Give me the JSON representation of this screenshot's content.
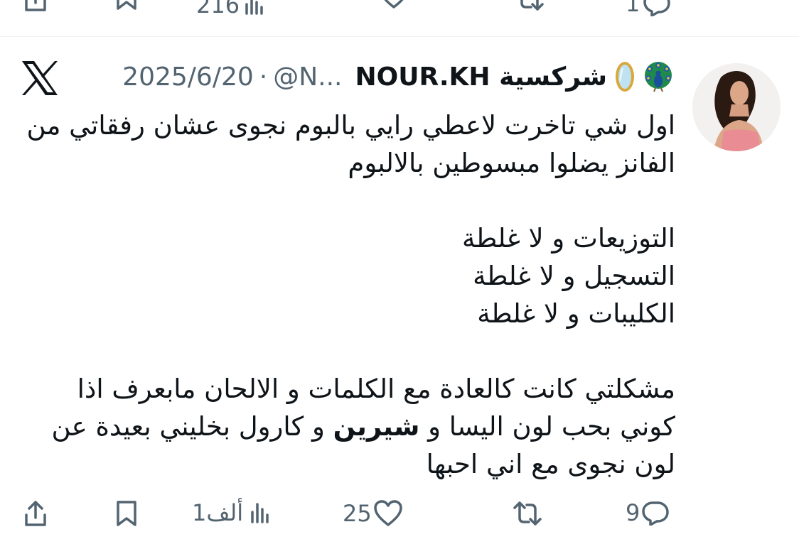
{
  "previous_tweet_actions": {
    "views": "216",
    "replies": "1"
  },
  "header": {
    "display_name": "NOUR.KH",
    "display_name_suffix": "شركسية",
    "emoji_1": "mirror-emoji",
    "emoji_2": "peacock-emoji",
    "handle": "@N...",
    "separator": "·",
    "date": "2025/6/20"
  },
  "tweet": {
    "line_1": "اول شي تاخرت لاعطي رايي بالبوم نجوى عشان رفقاتي من",
    "line_2": "الفانز يضلوا مبسوطين بالالبوم",
    "line_3": "التوزيعات و لا غلطة",
    "line_4": "التسجيل و لا غلطة",
    "line_5": "الكليبات و لا غلطة",
    "line_6": "مشكلتي كانت كالعادة مع الكلمات و الالحان مابعرف اذا",
    "line_7_before": "كوني بحب لون اليسا و ",
    "line_7_bold": "شيرين",
    "line_7_after": " و كارول بخليني بعيدة عن",
    "line_8": "لون نجوى مع اني احبها"
  },
  "actions": {
    "replies": "9",
    "likes": "25",
    "views": "1ألف"
  },
  "colors": {
    "text": "#0f1419",
    "secondary": "#536471",
    "divider": "#eff3f4",
    "avatar_dress": "#e98c94"
  },
  "icons": [
    "x-logo-icon",
    "reply-icon",
    "retweet-icon",
    "like-icon",
    "views-icon",
    "bookmark-icon",
    "share-icon"
  ]
}
